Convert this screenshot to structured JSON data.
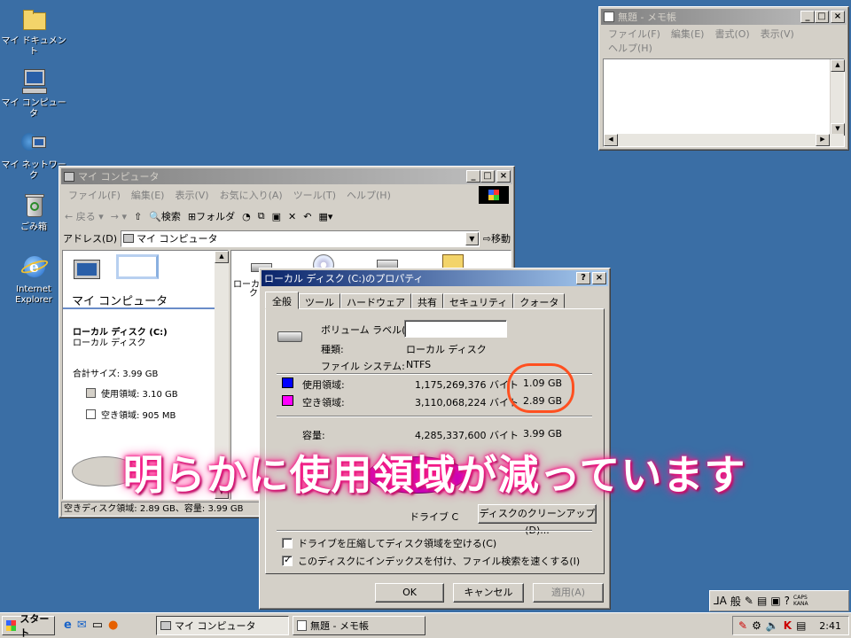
{
  "desktop": {
    "icons": [
      {
        "label": "マイ ドキュメント",
        "icon": "folder-icon"
      },
      {
        "label": "マイ コンピュータ",
        "icon": "computer-icon"
      },
      {
        "label": "マイ ネットワーク",
        "icon": "network-icon"
      },
      {
        "label": "ごみ箱",
        "icon": "recycle-bin-icon"
      },
      {
        "label": "Internet Explorer",
        "icon": "ie-icon"
      }
    ]
  },
  "notepad": {
    "title": "無題 - メモ帳",
    "menu": [
      "ファイル(F)",
      "編集(E)",
      "書式(O)",
      "表示(V)",
      "ヘルプ(H)"
    ]
  },
  "explorer": {
    "title": "マイ コンピュータ",
    "menu": [
      "ファイル(F)",
      "編集(E)",
      "表示(V)",
      "お気に入り(A)",
      "ツール(T)",
      "ヘルプ(H)"
    ],
    "toolbar": {
      "back": "戻る",
      "search": "検索",
      "folders": "フォルダ"
    },
    "address_label": "アドレス(D)",
    "address_value": "マイ コンピュータ",
    "go_label": "移動",
    "panel_title": "マイ コンピュータ",
    "drive_name": "ローカル ディスク (C:)",
    "drive_type": "ローカル ディスク",
    "total_size": "合計サイズ: 3.99 GB",
    "used_label": "使用領域: 3.10 GB",
    "free_label": "空き領域: 905 MB",
    "file_label_1": "ローカル",
    "file_label_2": "ク",
    "status": "空きディスク領域: 2.89 GB、容量: 3.99 GB"
  },
  "properties": {
    "title": "ローカル ディスク (C:)のプロパティ",
    "tabs": [
      "全般",
      "ツール",
      "ハードウェア",
      "共有",
      "セキュリティ",
      "クォータ"
    ],
    "volume_label": "ボリューム ラベル(L):",
    "type_label": "種類:",
    "type_value": "ローカル ディスク",
    "fs_label": "ファイル システム:",
    "fs_value": "NTFS",
    "used_label": "使用領域:",
    "used_bytes": "1,175,269,376 バイト",
    "used_gb": "1.09 GB",
    "free_label": "空き領域:",
    "free_bytes": "3,110,068,224 バイト",
    "free_gb": "2.89 GB",
    "capacity_label": "容量:",
    "capacity_bytes": "4,285,337,600 バイト",
    "capacity_gb": "3.99 GB",
    "drive_label": "ドライブ C",
    "cleanup": "ディスクのクリーンアップ(D)...",
    "compress": "ドライブを圧縮してディスク領域を空ける(C)",
    "index": "このディスクにインデックスを付け、ファイル検索を速くする(I)",
    "ok": "OK",
    "cancel": "キャンセル",
    "apply": "適用(A)",
    "colors": {
      "used": "#0000ff",
      "free": "#ff00ff"
    }
  },
  "subtitle": "明らかに使用領域が減っています",
  "taskbar": {
    "start": "スタート",
    "tasks": [
      "マイ コンピュータ",
      "無題 - メモ帳"
    ],
    "ime": "般",
    "clock": "2:41",
    "caps": "CAPS",
    "kana": "KANA"
  }
}
